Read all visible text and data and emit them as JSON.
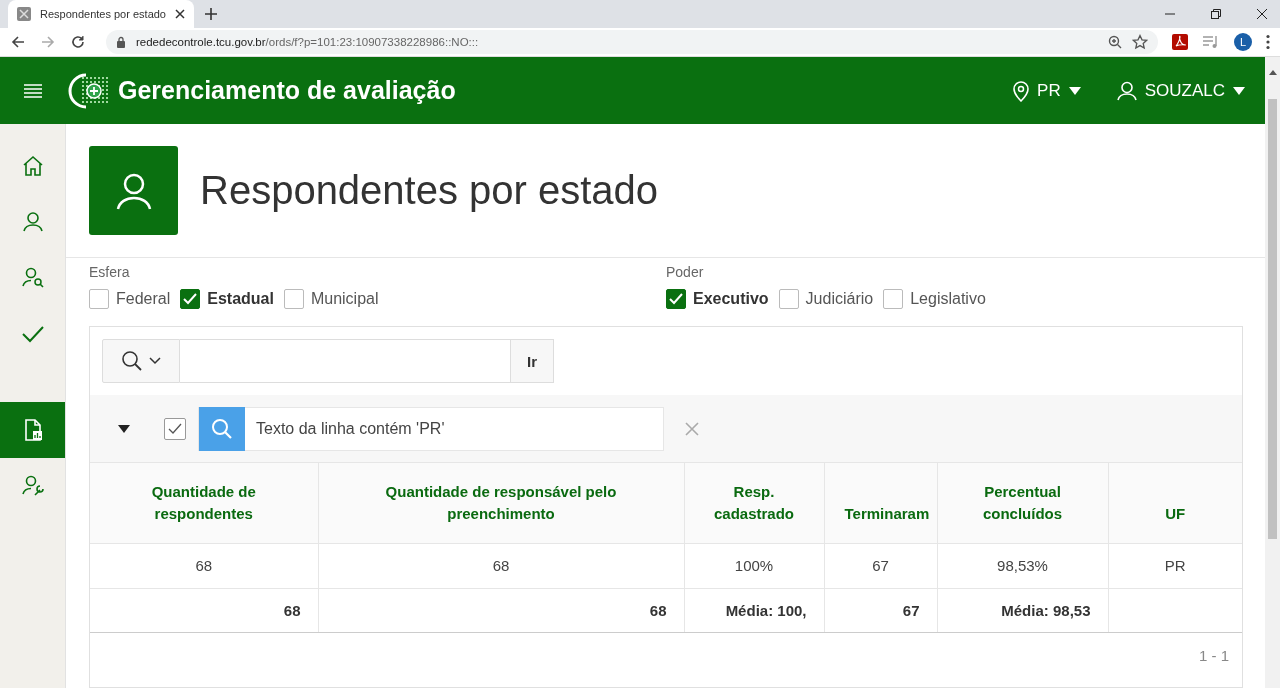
{
  "browser": {
    "tab_title": "Respondentes por estado",
    "url_host": "rededecontrole.tcu.gov.br",
    "url_path": "/ords/f?p=101:23:10907338228986::NO:::",
    "profile_letter": "L"
  },
  "header": {
    "title": "Gerenciamento de avaliação",
    "region": "PR",
    "user": "SOUZALC"
  },
  "sidebar": {
    "items": [
      {
        "kind": "home",
        "selected": false
      },
      {
        "kind": "user",
        "selected": false
      },
      {
        "kind": "user-search",
        "selected": false
      },
      {
        "kind": "check",
        "selected": false
      },
      {
        "kind": "report",
        "selected": true
      },
      {
        "kind": "user-settings",
        "selected": false
      }
    ]
  },
  "page_title": "Respondentes por estado",
  "filters": [
    {
      "label": "Esfera",
      "options": [
        {
          "label": "Federal",
          "checked": false
        },
        {
          "label": "Estadual",
          "checked": true
        },
        {
          "label": "Municipal",
          "checked": false
        }
      ]
    },
    {
      "label": "Poder",
      "options": [
        {
          "label": "Executivo",
          "checked": true
        },
        {
          "label": "Judiciário",
          "checked": false
        },
        {
          "label": "Legislativo",
          "checked": false
        }
      ]
    }
  ],
  "search": {
    "button": "Ir"
  },
  "active_filter": {
    "enabled": true,
    "text": "Texto da linha contém 'PR'"
  },
  "table": {
    "columns": [
      "Quantidade de respondentes",
      "Quantidade de responsável pelo preenchimento",
      "Resp. cadastrado",
      "Terminaram",
      "Percentual concluídos",
      "UF"
    ],
    "rows": [
      [
        "68",
        "68",
        "100%",
        "67",
        "98,53%",
        "PR"
      ]
    ],
    "totals": [
      "68",
      "68",
      "Média: 100,",
      "67",
      "Média: 98,53"
    ]
  },
  "pagination": "1 - 1"
}
